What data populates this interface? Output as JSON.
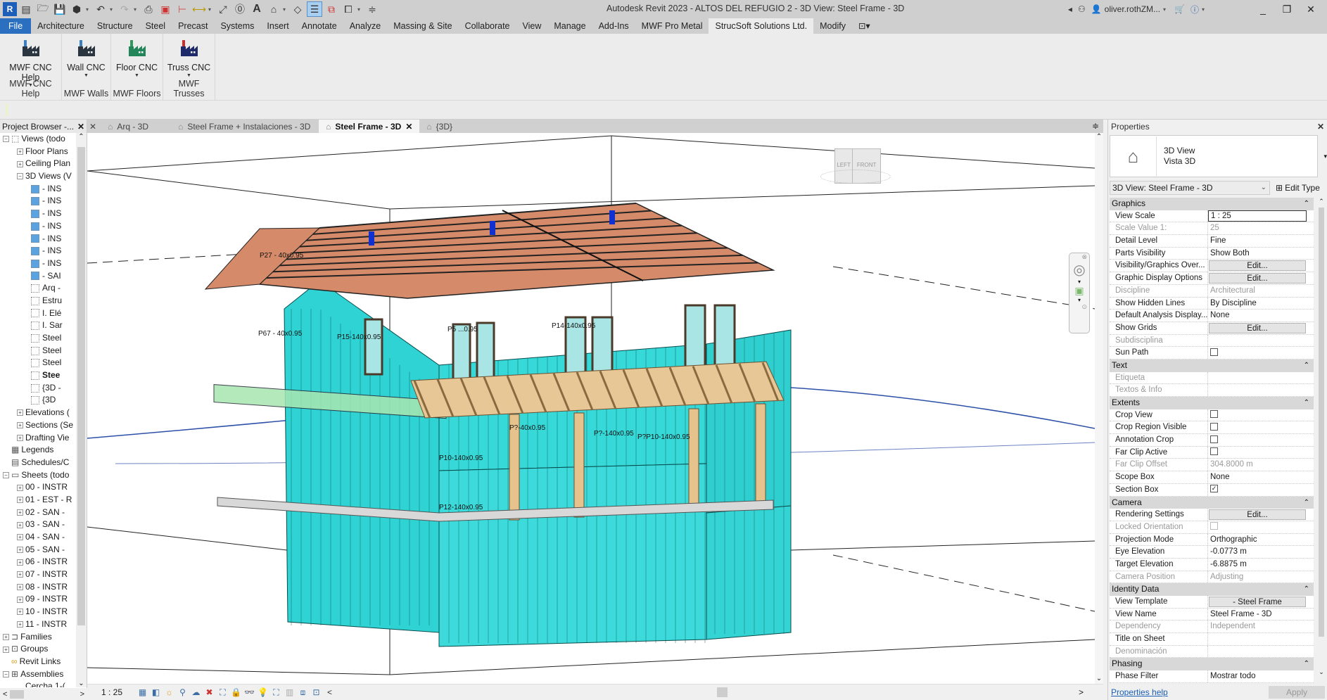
{
  "window": {
    "title": "Autodesk Revit 2023 - ALTOS DEL REFUGIO 2 - 3D View: Steel Frame - 3D",
    "user": "oliver.rothZM...",
    "controls": [
      "minimize",
      "restore",
      "close"
    ]
  },
  "quick_access": {
    "icons": [
      "revit-app-icon",
      "home-icon",
      "open-icon",
      "save-icon",
      "sync-icon",
      "undo-icon",
      "redo-icon",
      "print-icon",
      "export-pdf-icon",
      "measure-icon",
      "aligned-dimension-icon",
      "spot-icon",
      "tag-icon",
      "text-icon",
      "3d-view-icon",
      "section-icon",
      "thin-lines-icon",
      "close-hidden-icon",
      "switch-windows-icon",
      "customize-icon"
    ]
  },
  "menu": {
    "tabs": [
      "File",
      "Architecture",
      "Structure",
      "Steel",
      "Precast",
      "Systems",
      "Insert",
      "Annotate",
      "Analyze",
      "Massing & Site",
      "Collaborate",
      "View",
      "Manage",
      "Add-Ins",
      "MWF Pro Metal",
      "StrucSoft Solutions Ltd.",
      "Modify"
    ],
    "selected": "StrucSoft Solutions Ltd."
  },
  "ribbon": {
    "panels": [
      {
        "button": "MWF CNC Help",
        "panel": "MWF CNC Help",
        "color": "#3a7fc1"
      },
      {
        "button": "Wall CNC",
        "panel": "MWF Walls",
        "color": "#3a7fc1"
      },
      {
        "button": "Floor CNC",
        "panel": "MWF Floors",
        "color": "#2e9a5a"
      },
      {
        "button": "Truss CNC",
        "panel": "MWF Trusses",
        "color": "#c83030"
      }
    ]
  },
  "project_browser": {
    "title": "Project Browser -...",
    "items": [
      {
        "label": "Views (todo",
        "level": 0,
        "exp": "-",
        "icon": "views"
      },
      {
        "label": "Floor Plans",
        "level": 1,
        "exp": "+"
      },
      {
        "label": "Ceiling Plan",
        "level": 1,
        "exp": "+"
      },
      {
        "label": "3D Views (V",
        "level": 1,
        "exp": "-"
      },
      {
        "label": "- INS",
        "level": 2,
        "icon": "blue"
      },
      {
        "label": "- INS",
        "level": 2,
        "icon": "blue"
      },
      {
        "label": "- INS",
        "level": 2,
        "icon": "blue"
      },
      {
        "label": "- INS",
        "level": 2,
        "icon": "blue"
      },
      {
        "label": "- INS",
        "level": 2,
        "icon": "blue"
      },
      {
        "label": "- INS",
        "level": 2,
        "icon": "blue"
      },
      {
        "label": "- INS",
        "level": 2,
        "icon": "blue"
      },
      {
        "label": "- SAI",
        "level": 2,
        "icon": "blue"
      },
      {
        "label": "Arq -",
        "level": 2,
        "icon": "empty"
      },
      {
        "label": "Estru",
        "level": 2,
        "icon": "empty"
      },
      {
        "label": "I. Elé",
        "level": 2,
        "icon": "empty"
      },
      {
        "label": "I. Sar",
        "level": 2,
        "icon": "empty"
      },
      {
        "label": "Steel",
        "level": 2,
        "icon": "empty"
      },
      {
        "label": "Steel",
        "level": 2,
        "icon": "empty"
      },
      {
        "label": "Steel",
        "level": 2,
        "icon": "empty"
      },
      {
        "label": "Stee",
        "level": 2,
        "icon": "empty",
        "bold": true
      },
      {
        "label": "{3D -",
        "level": 2,
        "icon": "empty"
      },
      {
        "label": "{3D",
        "level": 2,
        "icon": "empty"
      },
      {
        "label": "Elevations (",
        "level": 1,
        "exp": "+"
      },
      {
        "label": "Sections (Se",
        "level": 1,
        "exp": "+"
      },
      {
        "label": "Drafting Vie",
        "level": 1,
        "exp": "+"
      },
      {
        "label": "Legends",
        "level": 0,
        "icon": "legend"
      },
      {
        "label": "Schedules/C",
        "level": 0,
        "icon": "schedule"
      },
      {
        "label": "Sheets (todo",
        "level": 0,
        "exp": "-",
        "icon": "sheet"
      },
      {
        "label": "00 - INSTR",
        "level": 1,
        "exp": "+"
      },
      {
        "label": "01 - EST - R",
        "level": 1,
        "exp": "+"
      },
      {
        "label": "02 - SAN -",
        "level": 1,
        "exp": "+"
      },
      {
        "label": "03 - SAN -",
        "level": 1,
        "exp": "+"
      },
      {
        "label": "04 - SAN -",
        "level": 1,
        "exp": "+"
      },
      {
        "label": "05 - SAN -",
        "level": 1,
        "exp": "+"
      },
      {
        "label": "06 - INSTR",
        "level": 1,
        "exp": "+"
      },
      {
        "label": "07 - INSTR",
        "level": 1,
        "exp": "+"
      },
      {
        "label": "08 - INSTR",
        "level": 1,
        "exp": "+"
      },
      {
        "label": "09 - INSTR",
        "level": 1,
        "exp": "+"
      },
      {
        "label": "10 - INSTR",
        "level": 1,
        "exp": "+"
      },
      {
        "label": "11 - INSTR",
        "level": 1,
        "exp": "+"
      },
      {
        "label": "Families",
        "level": 0,
        "exp": "+",
        "icon": "family"
      },
      {
        "label": "Groups",
        "level": 0,
        "exp": "+",
        "icon": "group"
      },
      {
        "label": "Revit Links",
        "level": 0,
        "icon": "link"
      },
      {
        "label": "Assemblies",
        "level": 0,
        "exp": "-",
        "icon": "assembly"
      },
      {
        "label": "Cercha 1-(",
        "level": 1
      }
    ]
  },
  "view_tabs": [
    {
      "label": "Arq - 3D",
      "selected": false
    },
    {
      "label": "Steel Frame + Instalaciones - 3D",
      "selected": false
    },
    {
      "label": "Steel Frame - 3D",
      "selected": true
    },
    {
      "label": "{3D}",
      "selected": false
    }
  ],
  "viewport": {
    "viewcube": {
      "left": "LEFT",
      "front": "FRONT"
    },
    "tags": [
      "P27 - 40x0.95",
      "P67 - 40x0.95",
      "P15-140x0.95",
      "P5 ...0.95",
      "P14-140x0.95",
      "P?-40x0.95",
      "P?-140x0.95",
      "P?P10-140x0.95",
      "P10-140x0.95",
      "P12-140x0.95"
    ]
  },
  "status": {
    "scale": "1 : 25"
  },
  "properties": {
    "title": "Properties",
    "type_name": "3D View",
    "type_sub": "Vista 3D",
    "instance": "3D View: Steel Frame - 3D",
    "edit_type": "Edit Type",
    "groups": [
      {
        "name": "Graphics",
        "rows": [
          {
            "k": "View Scale",
            "v": "1 : 25",
            "kind": "scalebox"
          },
          {
            "k": "Scale Value    1:",
            "v": "25",
            "disabled": true
          },
          {
            "k": "Detail Level",
            "v": "Fine"
          },
          {
            "k": "Parts Visibility",
            "v": "Show Both"
          },
          {
            "k": "Visibility/Graphics Over...",
            "v": "Edit...",
            "kind": "button"
          },
          {
            "k": "Graphic Display Options",
            "v": "Edit...",
            "kind": "button"
          },
          {
            "k": "Discipline",
            "v": "Architectural",
            "disabled": true
          },
          {
            "k": "Show Hidden Lines",
            "v": "By Discipline"
          },
          {
            "k": "Default Analysis Display...",
            "v": "None"
          },
          {
            "k": "Show Grids",
            "v": "Edit...",
            "kind": "button"
          },
          {
            "k": "Subdisciplina",
            "v": "",
            "disabled": true
          },
          {
            "k": "Sun Path",
            "v": false,
            "kind": "checkbox"
          }
        ]
      },
      {
        "name": "Text",
        "rows": [
          {
            "k": "Etiqueta",
            "v": "",
            "disabled": true
          },
          {
            "k": "Textos & Info",
            "v": "",
            "disabled": true
          }
        ]
      },
      {
        "name": "Extents",
        "rows": [
          {
            "k": "Crop View",
            "v": false,
            "kind": "checkbox"
          },
          {
            "k": "Crop Region Visible",
            "v": false,
            "kind": "checkbox"
          },
          {
            "k": "Annotation Crop",
            "v": false,
            "kind": "checkbox"
          },
          {
            "k": "Far Clip Active",
            "v": false,
            "kind": "checkbox"
          },
          {
            "k": "Far Clip Offset",
            "v": "304.8000 m",
            "disabled": true
          },
          {
            "k": "Scope Box",
            "v": "None"
          },
          {
            "k": "Section Box",
            "v": true,
            "kind": "checkbox"
          }
        ]
      },
      {
        "name": "Camera",
        "rows": [
          {
            "k": "Rendering Settings",
            "v": "Edit...",
            "kind": "button"
          },
          {
            "k": "Locked Orientation",
            "v": false,
            "kind": "checkbox",
            "disabled": true
          },
          {
            "k": "Projection Mode",
            "v": "Orthographic"
          },
          {
            "k": "Eye Elevation",
            "v": "-0.0773 m"
          },
          {
            "k": "Target Elevation",
            "v": "-6.8875 m"
          },
          {
            "k": "Camera Position",
            "v": "Adjusting",
            "disabled": true
          }
        ]
      },
      {
        "name": "Identity Data",
        "rows": [
          {
            "k": "View Template",
            "v": "- Steel Frame",
            "kind": "button"
          },
          {
            "k": "View Name",
            "v": "Steel Frame - 3D"
          },
          {
            "k": "Dependency",
            "v": "Independent",
            "disabled": true
          },
          {
            "k": "Title on Sheet",
            "v": ""
          },
          {
            "k": "Denominación",
            "v": "",
            "disabled": true
          }
        ]
      },
      {
        "name": "Phasing",
        "rows": [
          {
            "k": "Phase Filter",
            "v": "Mostrar todo"
          }
        ]
      }
    ],
    "help": "Properties help",
    "apply": "Apply"
  }
}
